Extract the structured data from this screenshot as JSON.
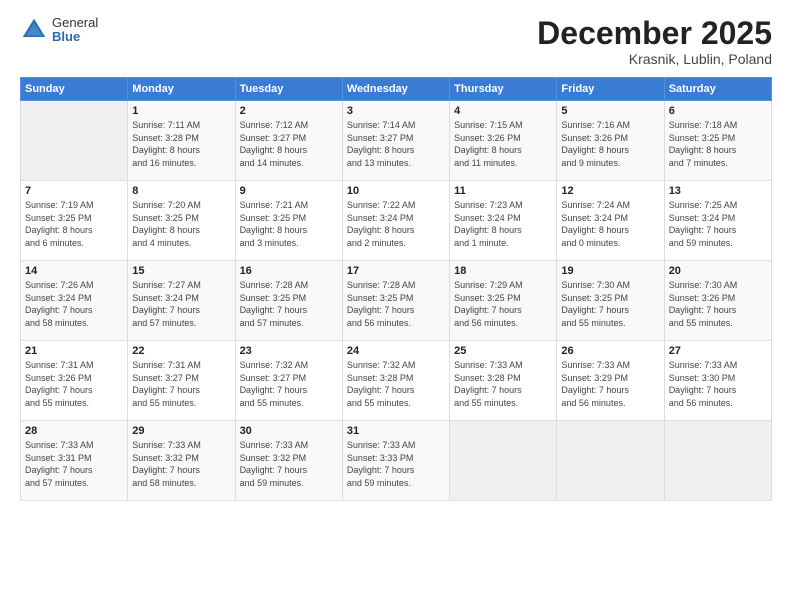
{
  "header": {
    "logo_general": "General",
    "logo_blue": "Blue",
    "month_title": "December 2025",
    "subtitle": "Krasnik, Lublin, Poland"
  },
  "calendar": {
    "days_of_week": [
      "Sunday",
      "Monday",
      "Tuesday",
      "Wednesday",
      "Thursday",
      "Friday",
      "Saturday"
    ],
    "weeks": [
      [
        {
          "day": "",
          "info": ""
        },
        {
          "day": "1",
          "info": "Sunrise: 7:11 AM\nSunset: 3:28 PM\nDaylight: 8 hours\nand 16 minutes."
        },
        {
          "day": "2",
          "info": "Sunrise: 7:12 AM\nSunset: 3:27 PM\nDaylight: 8 hours\nand 14 minutes."
        },
        {
          "day": "3",
          "info": "Sunrise: 7:14 AM\nSunset: 3:27 PM\nDaylight: 8 hours\nand 13 minutes."
        },
        {
          "day": "4",
          "info": "Sunrise: 7:15 AM\nSunset: 3:26 PM\nDaylight: 8 hours\nand 11 minutes."
        },
        {
          "day": "5",
          "info": "Sunrise: 7:16 AM\nSunset: 3:26 PM\nDaylight: 8 hours\nand 9 minutes."
        },
        {
          "day": "6",
          "info": "Sunrise: 7:18 AM\nSunset: 3:25 PM\nDaylight: 8 hours\nand 7 minutes."
        }
      ],
      [
        {
          "day": "7",
          "info": "Sunrise: 7:19 AM\nSunset: 3:25 PM\nDaylight: 8 hours\nand 6 minutes."
        },
        {
          "day": "8",
          "info": "Sunrise: 7:20 AM\nSunset: 3:25 PM\nDaylight: 8 hours\nand 4 minutes."
        },
        {
          "day": "9",
          "info": "Sunrise: 7:21 AM\nSunset: 3:25 PM\nDaylight: 8 hours\nand 3 minutes."
        },
        {
          "day": "10",
          "info": "Sunrise: 7:22 AM\nSunset: 3:24 PM\nDaylight: 8 hours\nand 2 minutes."
        },
        {
          "day": "11",
          "info": "Sunrise: 7:23 AM\nSunset: 3:24 PM\nDaylight: 8 hours\nand 1 minute."
        },
        {
          "day": "12",
          "info": "Sunrise: 7:24 AM\nSunset: 3:24 PM\nDaylight: 8 hours\nand 0 minutes."
        },
        {
          "day": "13",
          "info": "Sunrise: 7:25 AM\nSunset: 3:24 PM\nDaylight: 7 hours\nand 59 minutes."
        }
      ],
      [
        {
          "day": "14",
          "info": "Sunrise: 7:26 AM\nSunset: 3:24 PM\nDaylight: 7 hours\nand 58 minutes."
        },
        {
          "day": "15",
          "info": "Sunrise: 7:27 AM\nSunset: 3:24 PM\nDaylight: 7 hours\nand 57 minutes."
        },
        {
          "day": "16",
          "info": "Sunrise: 7:28 AM\nSunset: 3:25 PM\nDaylight: 7 hours\nand 57 minutes."
        },
        {
          "day": "17",
          "info": "Sunrise: 7:28 AM\nSunset: 3:25 PM\nDaylight: 7 hours\nand 56 minutes."
        },
        {
          "day": "18",
          "info": "Sunrise: 7:29 AM\nSunset: 3:25 PM\nDaylight: 7 hours\nand 56 minutes."
        },
        {
          "day": "19",
          "info": "Sunrise: 7:30 AM\nSunset: 3:25 PM\nDaylight: 7 hours\nand 55 minutes."
        },
        {
          "day": "20",
          "info": "Sunrise: 7:30 AM\nSunset: 3:26 PM\nDaylight: 7 hours\nand 55 minutes."
        }
      ],
      [
        {
          "day": "21",
          "info": "Sunrise: 7:31 AM\nSunset: 3:26 PM\nDaylight: 7 hours\nand 55 minutes."
        },
        {
          "day": "22",
          "info": "Sunrise: 7:31 AM\nSunset: 3:27 PM\nDaylight: 7 hours\nand 55 minutes."
        },
        {
          "day": "23",
          "info": "Sunrise: 7:32 AM\nSunset: 3:27 PM\nDaylight: 7 hours\nand 55 minutes."
        },
        {
          "day": "24",
          "info": "Sunrise: 7:32 AM\nSunset: 3:28 PM\nDaylight: 7 hours\nand 55 minutes."
        },
        {
          "day": "25",
          "info": "Sunrise: 7:33 AM\nSunset: 3:28 PM\nDaylight: 7 hours\nand 55 minutes."
        },
        {
          "day": "26",
          "info": "Sunrise: 7:33 AM\nSunset: 3:29 PM\nDaylight: 7 hours\nand 56 minutes."
        },
        {
          "day": "27",
          "info": "Sunrise: 7:33 AM\nSunset: 3:30 PM\nDaylight: 7 hours\nand 56 minutes."
        }
      ],
      [
        {
          "day": "28",
          "info": "Sunrise: 7:33 AM\nSunset: 3:31 PM\nDaylight: 7 hours\nand 57 minutes."
        },
        {
          "day": "29",
          "info": "Sunrise: 7:33 AM\nSunset: 3:32 PM\nDaylight: 7 hours\nand 58 minutes."
        },
        {
          "day": "30",
          "info": "Sunrise: 7:33 AM\nSunset: 3:32 PM\nDaylight: 7 hours\nand 59 minutes."
        },
        {
          "day": "31",
          "info": "Sunrise: 7:33 AM\nSunset: 3:33 PM\nDaylight: 7 hours\nand 59 minutes."
        },
        {
          "day": "",
          "info": ""
        },
        {
          "day": "",
          "info": ""
        },
        {
          "day": "",
          "info": ""
        }
      ]
    ]
  }
}
